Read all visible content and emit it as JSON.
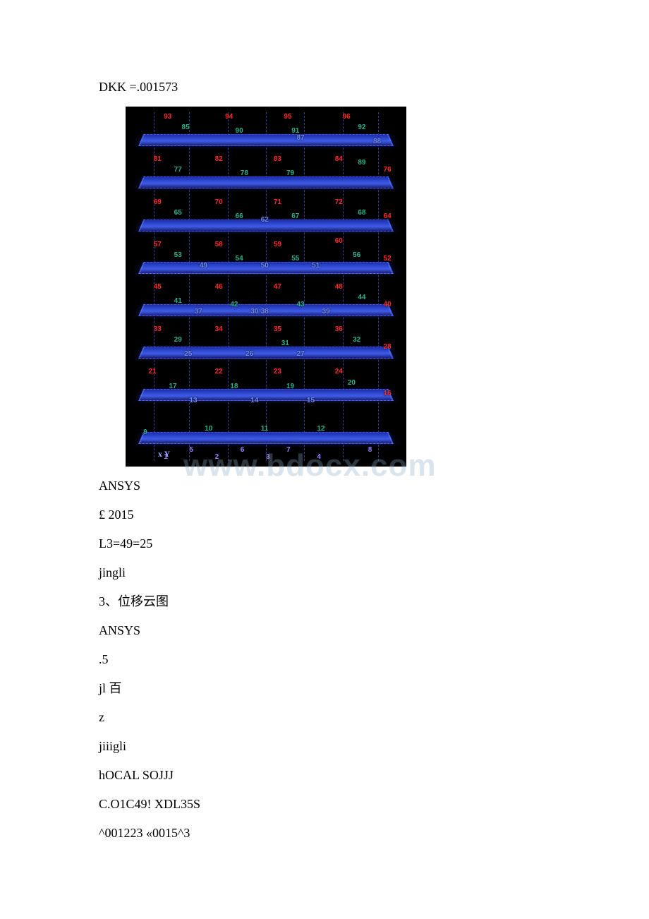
{
  "lines": {
    "l1": "DKK =.001573",
    "l2": "ANSYS",
    "l3": "£ 2015",
    "l4": "L3=49=25",
    "l5": "jingli",
    "l6": "3、位移云图",
    "l7": "ANSYS",
    "l8": ".5",
    "l9": "jl 百",
    "l10": "z",
    "l11": "jiiigli",
    "l12": "hOCAL SOJJJ",
    "l13": "C.O1C49! XDL35S",
    "l14": "^001223 «0015^3"
  },
  "figure": {
    "watermark": "www.bdocx.com",
    "axis": "x Y",
    "nodes": {
      "n93": "93",
      "n94": "94",
      "n95": "95",
      "n96": "96",
      "n85": "85",
      "n90": "90",
      "n91": "91",
      "n92": "92",
      "n87": "87",
      "n88": "88",
      "n81": "81",
      "n82": "82",
      "n83": "83",
      "n84": "84",
      "n77": "77",
      "n78": "78",
      "n79": "79",
      "n89": "89",
      "n76": "76",
      "n69": "69",
      "n70": "70",
      "n71": "71",
      "n72": "72",
      "n65": "65",
      "n66": "66",
      "n67": "67",
      "n68": "68",
      "n64": "64",
      "n62": "62",
      "n57": "57",
      "n58": "58",
      "n59": "59",
      "n60": "60",
      "n53": "53",
      "n54": "54",
      "n55": "55",
      "n56": "56",
      "n52": "52",
      "n49": "49",
      "n50": "50",
      "n51": "51",
      "n45": "45",
      "n46": "46",
      "n47": "47",
      "n48": "48",
      "n41": "41",
      "n42": "42",
      "n43": "43",
      "n44": "44",
      "n40": "40",
      "n37": "37",
      "n38": "38",
      "n39": "39",
      "n30": "30",
      "n33": "33",
      "n34": "34",
      "n35": "35",
      "n36": "36",
      "n29": "29",
      "n31": "31",
      "n32": "32",
      "n28": "28",
      "n25": "25",
      "n26": "26",
      "n27": "27",
      "n21": "21",
      "n22": "22",
      "n23": "23",
      "n24": "24",
      "n17": "17",
      "n18": "18",
      "n19": "19",
      "n20": "20",
      "n16": "16",
      "n13": "13",
      "n14": "14",
      "n15": "15",
      "n9": "9",
      "n10": "10",
      "n11": "11",
      "n12": "12",
      "n1": "1",
      "n2": "2",
      "n3": "3",
      "n4": "4",
      "n5": "5",
      "n6": "6",
      "n7": "7",
      "n8": "8"
    }
  }
}
